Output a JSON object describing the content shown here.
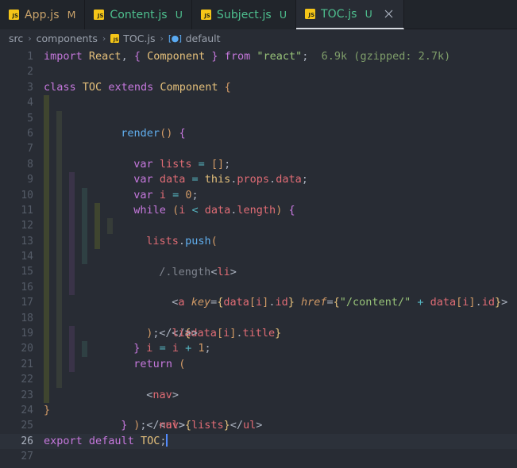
{
  "tabs": [
    {
      "label": "App.js",
      "badge": "M",
      "state": "m",
      "icon": "js-file-icon",
      "active": false,
      "closable": false
    },
    {
      "label": "Content.js",
      "badge": "U",
      "state": "u",
      "icon": "js-file-icon",
      "active": false,
      "closable": false
    },
    {
      "label": "Subject.js",
      "badge": "U",
      "state": "u",
      "icon": "js-file-icon",
      "active": false,
      "closable": false
    },
    {
      "label": "TOC.js",
      "badge": "U",
      "state": "u",
      "icon": "js-file-icon",
      "active": true,
      "closable": true
    }
  ],
  "breadcrumb": {
    "items": [
      "src",
      "components",
      "TOC.js",
      "default"
    ],
    "separator": "›",
    "file_icon": "js-file-icon",
    "symbol_icon": "symbol-field-icon"
  },
  "editor": {
    "language": "javascript",
    "filename": "TOC.js",
    "import_cost": "6.9k (gzipped: 2.7k)",
    "cursor_line": 26,
    "cursor_column": 22,
    "total_lines": 27,
    "lines": [
      {
        "n": 1,
        "text": "import React, { Component } from \"react\";"
      },
      {
        "n": 2,
        "text": ""
      },
      {
        "n": 3,
        "text": "class TOC extends Component {"
      },
      {
        "n": 4,
        "text": "  render() {"
      },
      {
        "n": 5,
        "text": "    var lists = [];"
      },
      {
        "n": 6,
        "text": "    var data = this.props.data;"
      },
      {
        "n": 7,
        "text": "    var i = 0;"
      },
      {
        "n": 8,
        "text": "    while (i < data.length) {"
      },
      {
        "n": 9,
        "text": "      lists.push("
      },
      {
        "n": 10,
        "text": "        /.length<li>"
      },
      {
        "n": 11,
        "text": "          <a key={data[i].id} href={\"/content/\" + data[i].id}>"
      },
      {
        "n": 12,
        "text": "            {data[i].title}"
      },
      {
        "n": 13,
        "text": "          </a>"
      },
      {
        "n": 14,
        "text": "        </li>"
      },
      {
        "n": 15,
        "text": "      );"
      },
      {
        "n": 16,
        "text": "      i = i + 1;"
      },
      {
        "n": 17,
        "text": "    }"
      },
      {
        "n": 18,
        "text": "    return ("
      },
      {
        "n": 19,
        "text": "      <nav>"
      },
      {
        "n": 20,
        "text": "        <ul>{lists}</ul>"
      },
      {
        "n": 21,
        "text": "      </nav>"
      },
      {
        "n": 22,
        "text": "    );"
      },
      {
        "n": 23,
        "text": "  }"
      },
      {
        "n": 24,
        "text": "}"
      },
      {
        "n": 25,
        "text": ""
      },
      {
        "n": 26,
        "text": "export default TOC;"
      },
      {
        "n": 27,
        "text": ""
      }
    ]
  },
  "colors": {
    "editor_background": "#282c34",
    "tabbar_background": "#21252b",
    "active_tab_background": "#282c34",
    "active_tab_border": "#d7dae0",
    "active_line_background": "#2c313a",
    "line_number": "#555c68",
    "active_line_number": "#abb2bf",
    "cursor": "#528bff",
    "keyword": "#c678dd",
    "string": "#98c379",
    "variable": "#e06c75",
    "class_name": "#e5c07b",
    "function": "#61afef",
    "number": "#d19a66",
    "operator": "#56b6c2",
    "comment": "#7f848e",
    "modified_badge": "#c8a26a",
    "untracked_badge": "#4ec08f",
    "import_cost": "#7f9e6a",
    "js_icon": "#f5c518"
  }
}
